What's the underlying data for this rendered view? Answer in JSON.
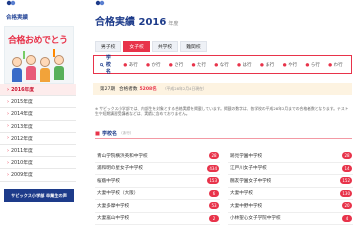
{
  "sidebar": {
    "title": "合格実績",
    "banner_text": "合格おめでとう",
    "years": [
      {
        "label": "2016年度",
        "active": true
      },
      {
        "label": "2015年度",
        "active": false
      },
      {
        "label": "2014年度",
        "active": false
      },
      {
        "label": "2013年度",
        "active": false
      },
      {
        "label": "2012年度",
        "active": false
      },
      {
        "label": "2011年度",
        "active": false
      },
      {
        "label": "2010年度",
        "active": false
      },
      {
        "label": "2009年度",
        "active": false
      }
    ],
    "button_label": "サピックス小学部 卒業生の声"
  },
  "main": {
    "title": "合格実績 2016",
    "title_suffix": "年度",
    "tabs": [
      {
        "label": "男子校",
        "active": false
      },
      {
        "label": "女子校",
        "active": true
      },
      {
        "label": "共学校",
        "active": false
      },
      {
        "label": "難関校",
        "active": false
      }
    ],
    "search_label": "学校名",
    "kana": [
      "あ行",
      "か行",
      "さ行",
      "た行",
      "な行",
      "は行",
      "ま行",
      "や行",
      "ら行",
      "わ行"
    ],
    "result": {
      "prefix": "第27期",
      "label": "合格者数",
      "count": "5208名",
      "note": "（平成28年2月4日現在）"
    },
    "notes": "※ サピックス小学部では、内部生を対象とする合格実績を掲載しています。掲載の数字は、各学校の平成28年2月までの合格者数となります。テスト生や短期講習受講者などは、実績に含めておりません。",
    "section_title": "学校名",
    "section_sub": "（あ行）",
    "schools_left": [
      {
        "name": "青山学院横浜英和中学校",
        "count": "28"
      },
      {
        "name": "浦和明の星女子中学校",
        "count": "434"
      },
      {
        "name": "桜蔭中学校",
        "count": "153"
      },
      {
        "name": "大妻中学校（大阪）",
        "count": "6"
      },
      {
        "name": "大妻多摩中学校",
        "count": "53"
      },
      {
        "name": "大妻嵐山中学校",
        "count": "2"
      }
    ],
    "schools_right": [
      {
        "name": "跡見学園中学校",
        "count": "28"
      },
      {
        "name": "江戸川女子中学校",
        "count": "14"
      },
      {
        "name": "鷗友学園女子中学校",
        "count": "152"
      },
      {
        "name": "大妻中学校",
        "count": "130"
      },
      {
        "name": "大妻中野中学校",
        "count": "20"
      },
      {
        "name": "小林聖心女子学院中学校",
        "count": "4"
      }
    ]
  },
  "colors": {
    "accent": "#e8334a",
    "navy": "#1d3b8a",
    "result_bg": "#fdf3e1"
  }
}
